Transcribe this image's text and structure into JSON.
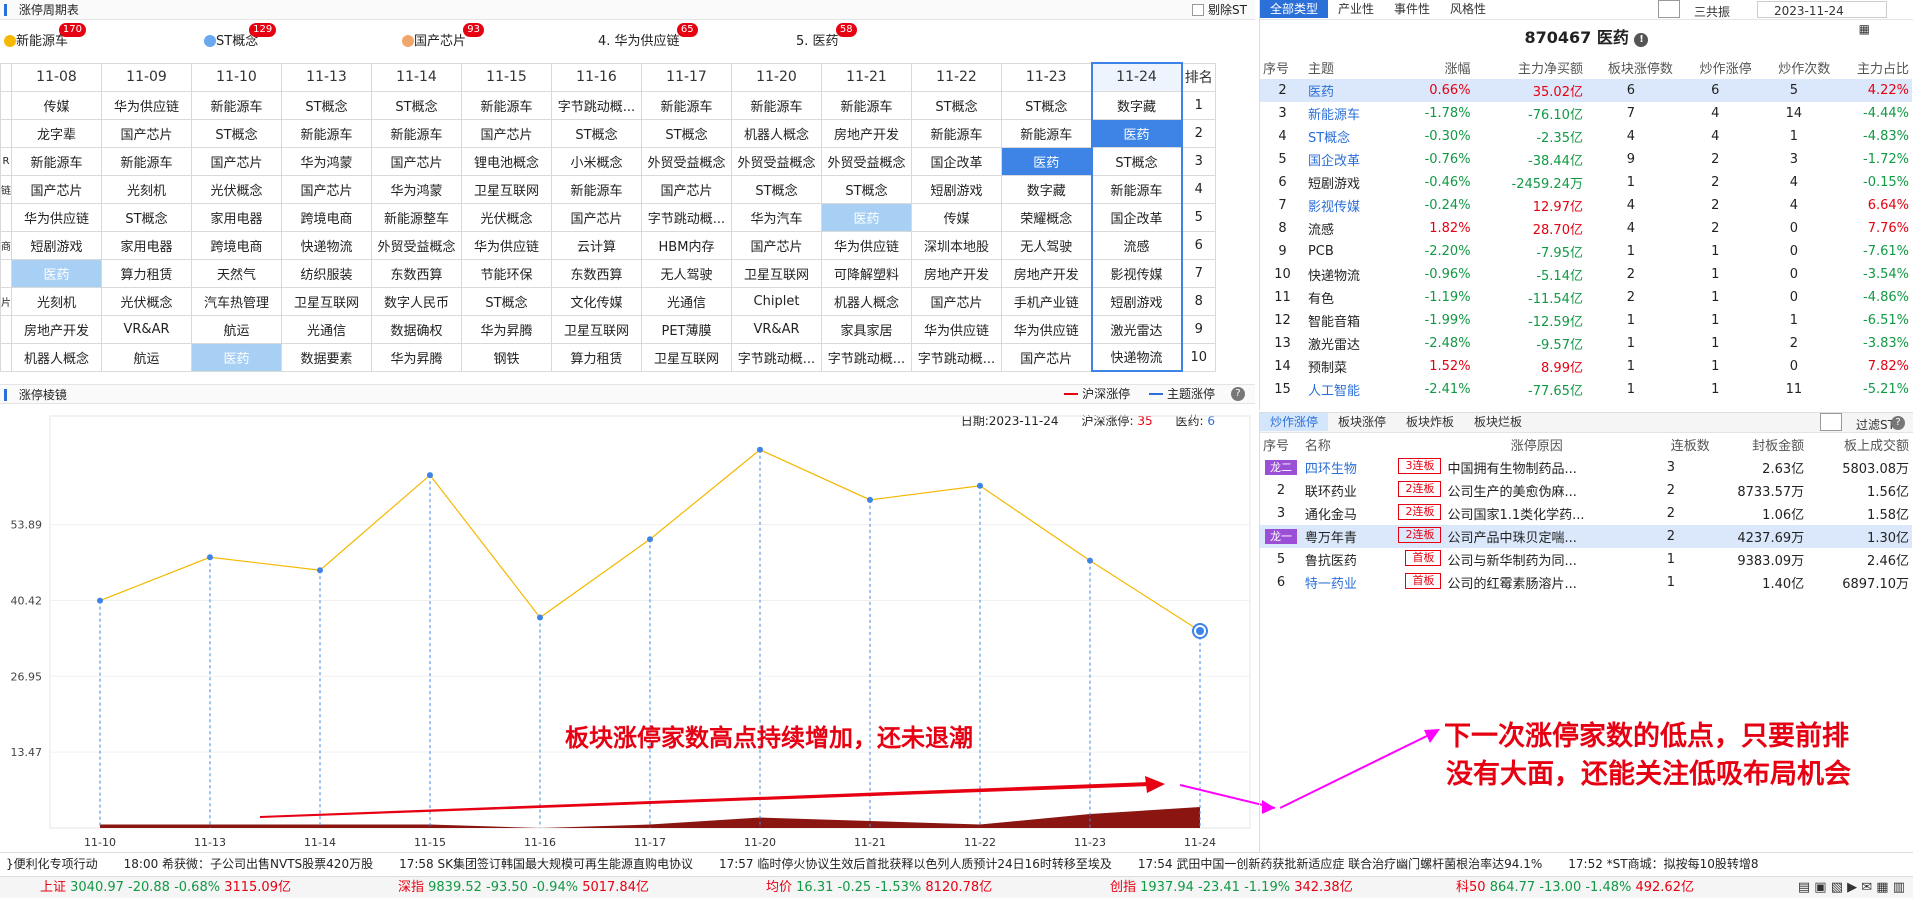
{
  "cycle": {
    "title": "涨停周期表",
    "exclude_st": "剔除ST",
    "themes": [
      {
        "name": "新能源车",
        "count": "170",
        "prefix": "",
        "color": "#f6b800"
      },
      {
        "name": "ST概念",
        "count": "129",
        "prefix": "",
        "color": "#6aa8f0"
      },
      {
        "name": "国产芯片",
        "count": "93",
        "prefix": "",
        "color": "#f0a86a"
      },
      {
        "name": "华为供应链",
        "count": "65",
        "prefix": "4.",
        "color": ""
      },
      {
        "name": "医药",
        "count": "58",
        "prefix": "5.",
        "color": ""
      }
    ],
    "dates": [
      "11-08",
      "11-09",
      "11-10",
      "11-13",
      "11-14",
      "11-15",
      "11-16",
      "11-17",
      "11-20",
      "11-21",
      "11-22",
      "11-23",
      "11-24"
    ],
    "rank_header": "排名",
    "left_clip": [
      "",
      "",
      "",
      "R",
      "链",
      "",
      "商",
      "",
      "片",
      "",
      ""
    ],
    "rows": [
      [
        "传媒",
        "华为供应链",
        "新能源车",
        "ST概念",
        "ST概念",
        "新能源车",
        "字节跳动概...",
        "新能源车",
        "新能源车",
        "新能源车",
        "ST概念",
        "ST概念",
        "数字藏"
      ],
      [
        "龙字辈",
        "国产芯片",
        "ST概念",
        "新能源车",
        "新能源车",
        "国产芯片",
        "ST概念",
        "ST概念",
        "机器人概念",
        "房地产开发",
        "新能源车",
        "新能源车",
        "医药"
      ],
      [
        "新能源车",
        "新能源车",
        "国产芯片",
        "华为鸿蒙",
        "国产芯片",
        "锂电池概念",
        "小米概念",
        "外贸受益概念",
        "外贸受益概念",
        "外贸受益概念",
        "国企改革",
        "医药",
        "ST概念"
      ],
      [
        "国产芯片",
        "光刻机",
        "光伏概念",
        "国产芯片",
        "华为鸿蒙",
        "卫星互联网",
        "新能源车",
        "国产芯片",
        "ST概念",
        "ST概念",
        "短剧游戏",
        "数字藏",
        "新能源车"
      ],
      [
        "华为供应链",
        "ST概念",
        "家用电器",
        "跨境电商",
        "新能源整车",
        "光伏概念",
        "国产芯片",
        "字节跳动概...",
        "华为汽车",
        "医药",
        "传媒",
        "荣耀概念",
        "国企改革"
      ],
      [
        "短剧游戏",
        "家用电器",
        "跨境电商",
        "快递物流",
        "外贸受益概念",
        "华为供应链",
        "云计算",
        "HBM内存",
        "国产芯片",
        "华为供应链",
        "深圳本地股",
        "无人驾驶",
        "流感"
      ],
      [
        "医药",
        "算力租赁",
        "天然气",
        "纺织服装",
        "东数西算",
        "节能环保",
        "东数西算",
        "无人驾驶",
        "卫星互联网",
        "可降解塑料",
        "房地产开发",
        "房地产开发",
        "影视传媒"
      ],
      [
        "光刻机",
        "光伏概念",
        "汽车热管理",
        "卫星互联网",
        "数字人民币",
        "ST概念",
        "文化传媒",
        "光通信",
        "Chiplet",
        "机器人概念",
        "国产芯片",
        "手机产业链",
        "短剧游戏"
      ],
      [
        "房地产开发",
        "VR&AR",
        "航运",
        "光通信",
        "数据确权",
        "华为昇腾",
        "卫星互联网",
        "PET薄膜",
        "VR&AR",
        "家具家居",
        "华为供应链",
        "华为供应链",
        "激光雷达"
      ],
      [
        "机器人概念",
        "航运",
        "医药",
        "数据要素",
        "华为昇腾",
        "钢铁",
        "算力租赁",
        "卫星互联网",
        "字节跳动概...",
        "字节跳动概...",
        "字节跳动概...",
        "国产芯片",
        "快递物流"
      ]
    ]
  },
  "mirror": {
    "title": "涨停棱镜",
    "legend_hs": "沪深涨停",
    "legend_theme": "主题涨停",
    "date_label": "日期:",
    "date": "2023-11-24",
    "hs_label": "沪深涨停:",
    "hs_value": "35",
    "theme_label": "医药:",
    "theme_value": "6",
    "annotation_main": "板块涨停家数高点持续增加，还未退潮",
    "annotation_right_1": "下一次涨停家数的低点，只要前排",
    "annotation_right_2": "没有大面，还能关注低吸布局机会"
  },
  "chart_data": {
    "type": "line",
    "categories": [
      "11-10",
      "11-13",
      "11-14",
      "11-15",
      "11-16",
      "11-17",
      "11-20",
      "11-21",
      "11-22",
      "11-23",
      "11-24"
    ],
    "series": [
      {
        "name": "沪深涨停",
        "values": [
          40.4,
          48.1,
          45.8,
          62.7,
          37.4,
          51.3,
          67.2,
          58.3,
          60.8,
          47.5,
          35.0
        ],
        "color": "#f5b800"
      },
      {
        "name": "主题涨停",
        "values": [
          1,
          1,
          1,
          1,
          0,
          1,
          3,
          2,
          1,
          4,
          6
        ],
        "color": "#8b1510"
      }
    ],
    "yticks": [
      "13.47",
      "26.95",
      "40.42",
      "53.89"
    ],
    "ylim": [
      0,
      70
    ]
  },
  "right_top": {
    "tabs": [
      "全部类型",
      "产业性",
      "事件性",
      "风格性"
    ],
    "sanggongzhen": "三共振",
    "date": "2023-11-24",
    "stock_code": "870467 医药",
    "columns": [
      "序号",
      "主题",
      "涨幅",
      "主力净买额",
      "板块涨停数",
      "炒作涨停",
      "炒作次数",
      "主力占比"
    ],
    "rows": [
      [
        "2",
        "医药",
        "0.66%",
        "35.02亿",
        "6",
        "6",
        "5",
        "4.22%"
      ],
      [
        "3",
        "新能源车",
        "-1.78%",
        "-76.10亿",
        "7",
        "4",
        "14",
        "-4.44%"
      ],
      [
        "4",
        "ST概念",
        "-0.30%",
        "-2.35亿",
        "4",
        "4",
        "1",
        "-4.83%"
      ],
      [
        "5",
        "国企改革",
        "-0.76%",
        "-38.44亿",
        "9",
        "2",
        "3",
        "-1.72%"
      ],
      [
        "6",
        "短剧游戏",
        "-0.46%",
        "-2459.24万",
        "1",
        "2",
        "4",
        "-0.15%"
      ],
      [
        "7",
        "影视传媒",
        "-0.24%",
        "12.97亿",
        "4",
        "2",
        "4",
        "6.64%"
      ],
      [
        "8",
        "流感",
        "1.82%",
        "28.70亿",
        "4",
        "2",
        "0",
        "7.76%"
      ],
      [
        "9",
        "PCB",
        "-2.20%",
        "-7.95亿",
        "1",
        "1",
        "0",
        "-7.61%"
      ],
      [
        "10",
        "快递物流",
        "-0.96%",
        "-5.14亿",
        "2",
        "1",
        "0",
        "-3.54%"
      ],
      [
        "11",
        "有色",
        "-1.19%",
        "-11.54亿",
        "2",
        "1",
        "0",
        "-4.86%"
      ],
      [
        "12",
        "智能音箱",
        "-1.99%",
        "-12.59亿",
        "1",
        "1",
        "1",
        "-6.51%"
      ],
      [
        "13",
        "激光雷达",
        "-2.48%",
        "-9.57亿",
        "1",
        "1",
        "2",
        "-3.83%"
      ],
      [
        "14",
        "预制菜",
        "1.52%",
        "8.99亿",
        "1",
        "1",
        "0",
        "7.82%"
      ],
      [
        "15",
        "人工智能",
        "-2.41%",
        "-77.65亿",
        "1",
        "1",
        "11",
        "-5.21%"
      ]
    ],
    "blue_names": [
      "医药",
      "新能源车",
      "ST概念",
      "国企改革",
      "影视传媒",
      "人工智能"
    ]
  },
  "right_bot": {
    "tabs": [
      "炒作涨停",
      "板块涨停",
      "板块炸板",
      "板块烂板"
    ],
    "filter_st": "过滤ST",
    "columns": [
      "序号",
      "名称",
      "涨停原因",
      "连板数",
      "封板金额",
      "板上成交额"
    ],
    "rows": [
      {
        "rank": "龙二",
        "dragon": true,
        "name": "四环生物",
        "tag": "3连板",
        "reason": "中国拥有生物制药品...",
        "boards": "3",
        "seal": "2.63亿",
        "turnover": "5803.08万",
        "name_blue": true
      },
      {
        "rank": "2",
        "dragon": false,
        "name": "联环药业",
        "tag": "2连板",
        "reason": "公司生产的美愈伪麻...",
        "boards": "2",
        "seal": "8733.57万",
        "turnover": "1.56亿",
        "name_blue": false
      },
      {
        "rank": "3",
        "dragon": false,
        "name": "通化金马",
        "tag": "2连板",
        "reason": "公司国家1.1类化学药...",
        "boards": "2",
        "seal": "1.06亿",
        "turnover": "1.58亿",
        "name_blue": false
      },
      {
        "rank": "龙一",
        "dragon": true,
        "name": "粤万年青",
        "tag": "2连板",
        "reason": "公司产品中珠贝定喘...",
        "boards": "2",
        "seal": "4237.69万",
        "turnover": "1.30亿",
        "name_blue": false
      },
      {
        "rank": "5",
        "dragon": false,
        "name": "鲁抗医药",
        "tag": "首板",
        "reason": "公司与新华制药为同...",
        "boards": "1",
        "seal": "9383.09万",
        "turnover": "2.46亿",
        "name_blue": false
      },
      {
        "rank": "6",
        "dragon": false,
        "name": "特一药业",
        "tag": "首板",
        "reason": "公司的红霉素肠溶片...",
        "boards": "1",
        "seal": "1.40亿",
        "turnover": "6897.10万",
        "name_blue": true
      }
    ]
  },
  "news": [
    "}便利化专项行动",
    "18:00 希获微：子公司出售NVTS股票420万股",
    "17:58 SK集团签订韩国最大规模可再生能源直购电协议",
    "17:57 临时停火协议生效后首批获释以色列人质预计24日16时转移至埃及",
    "17:54 武田中国一创新药获批新适应症 联合治疗幽门螺杆菌根治率达94.1%",
    "17:52 *ST商城：拟按每10股转增8"
  ],
  "status": [
    {
      "name": "上证",
      "price": "3040.97",
      "chg": "-20.88",
      "pct": "-0.68%",
      "amt": "3115.09亿"
    },
    {
      "name": "深指",
      "price": "9839.52",
      "chg": "-93.50",
      "pct": "-0.94%",
      "amt": "5017.84亿"
    },
    {
      "name": "均价",
      "price": "16.31",
      "chg": "-0.25",
      "pct": "-1.53%",
      "amt": "8120.78亿"
    },
    {
      "name": "创指",
      "price": "1937.94",
      "chg": "-23.41",
      "pct": "-1.19%",
      "amt": "342.38亿"
    },
    {
      "name": "科50",
      "price": "864.77",
      "chg": "-13.00",
      "pct": "-1.48%",
      "amt": "492.62亿"
    }
  ]
}
